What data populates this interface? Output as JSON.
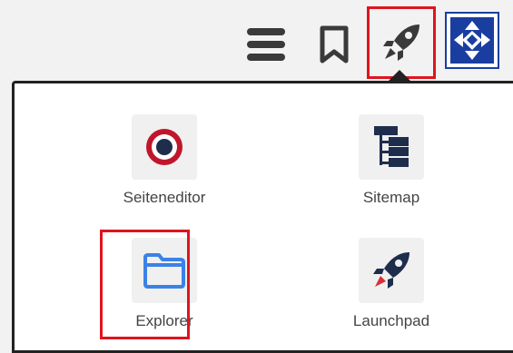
{
  "toolbar": {
    "menu_icon": "hamburger-menu-icon",
    "bookmark_icon": "bookmark-icon",
    "launchpad_icon": "rocket-icon",
    "avatar_icon": "user-avatar-logo",
    "highlight_color": "#e0141e"
  },
  "apps": [
    {
      "label": "Seiteneditor",
      "icon": "target-icon"
    },
    {
      "label": "Sitemap",
      "icon": "sitemap-icon"
    },
    {
      "label": "Explorer",
      "icon": "folder-icon"
    },
    {
      "label": "Launchpad",
      "icon": "rocket-icon"
    }
  ],
  "colors": {
    "icon_dark": "#1f2d4d",
    "target_red": "#c0162b",
    "folder_blue": "#3b82e6",
    "rocket_red": "#d9303a"
  }
}
